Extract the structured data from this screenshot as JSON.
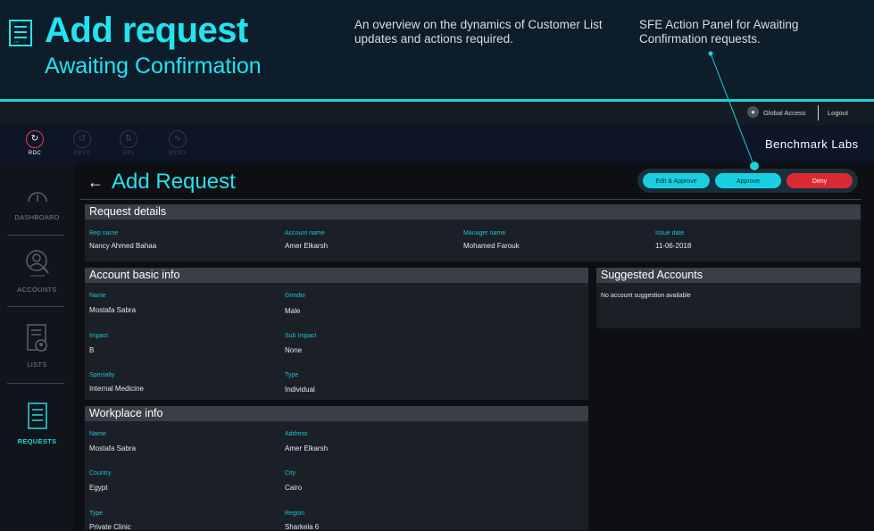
{
  "hero": {
    "title": "Add request",
    "subtitle": "Awaiting Confirmation",
    "description": "An overview on the dynamics of Customer List updates and actions required.",
    "callout": "SFE Action Panel for Awaiting Confirmation requests.",
    "icon": "document-list-icon"
  },
  "topbar": {
    "access_label": "Global Access",
    "logout_label": "Logout"
  },
  "apps": [
    {
      "label": "RDC",
      "active": true
    },
    {
      "label": "REVO",
      "active": false
    },
    {
      "label": "DRx",
      "active": false
    },
    {
      "label": "RIDEX",
      "active": false
    }
  ],
  "brand": "Benchmark Labs",
  "sidebar": {
    "items": [
      {
        "label": "DASHBOARD",
        "icon": "gauge-icon"
      },
      {
        "label": "ACCOUNTS",
        "icon": "account-search-icon"
      },
      {
        "label": "LISTS",
        "icon": "list-user-icon"
      },
      {
        "label": "REQUESTS",
        "icon": "document-list-icon"
      }
    ]
  },
  "page": {
    "title": "Add Request",
    "back_icon": "arrow-left-icon"
  },
  "actions": {
    "edit_approve": "Edit & Approve",
    "approve": "Approve",
    "deny": "Deny"
  },
  "request_details": {
    "title": "Request details",
    "rep_name_label": "Rep name",
    "rep_name": "Nancy Ahmed Bahaa",
    "account_name_label": "Account name",
    "account_name": "Amer Elkarsh",
    "manager_name_label": "Manager name",
    "manager_name": "Mohamed Farouk",
    "issue_date_label": "Issue date",
    "issue_date": "11-06-2018"
  },
  "account_info": {
    "title": "Account basic info",
    "name_label": "Name",
    "name": "Mostafa Sabra",
    "gender_label": "Gender",
    "gender": "Male",
    "impact_label": "Impact",
    "impact": "B",
    "sub_impact_label": "Sub Impact",
    "sub_impact": "None",
    "specialty_label": "Specialty",
    "specialty": "Internal Medicine",
    "type_label": "Type",
    "type": "Individual"
  },
  "suggested": {
    "title": "Suggested Accounts",
    "empty": "No account suggestion available"
  },
  "workplace": {
    "title": "Workplace info",
    "name_label": "Name",
    "name": "Mostafa Sabra",
    "address_label": "Address",
    "address": "Amer Elkarsh",
    "country_label": "Country",
    "country": "Egypt",
    "city_label": "City",
    "city": "Cairo",
    "type_label": "Type",
    "type": "Private Clinic",
    "region_label": "Region",
    "region": "Sharkela 6"
  },
  "colors": {
    "accent": "#22e3f0",
    "deny": "#d92a33",
    "background": "#0b1017"
  }
}
